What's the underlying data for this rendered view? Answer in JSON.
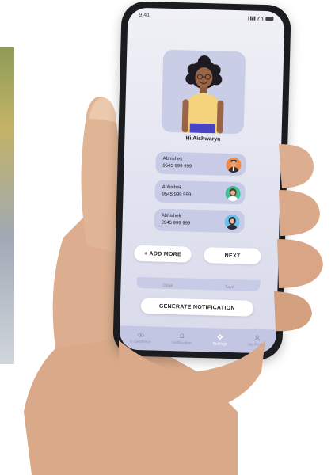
{
  "status": {
    "time": "9:41"
  },
  "greeting": "Hi Aishwarya",
  "contacts": [
    {
      "name": "Abhishek",
      "phone": "9545 999 999",
      "avatar": "male-avatar"
    },
    {
      "name": "Abhishek",
      "phone": "9545 999 999",
      "avatar": "female-avatar"
    },
    {
      "name": "Abhishek",
      "phone": "9545 999 999",
      "avatar": "female-avatar-2"
    }
  ],
  "buttons": {
    "add_more": "+ ADD MORE",
    "next": "NEXT",
    "generate": "GENERATE NOTIFICATION"
  },
  "hidden_row": {
    "left": "Close",
    "right": "Save"
  },
  "tabs": [
    {
      "label": "© Geofence",
      "icon": "eye-icon",
      "active": false
    },
    {
      "label": "Notification",
      "icon": "bell-icon",
      "active": false
    },
    {
      "label": "Settings",
      "icon": "gear-icon",
      "active": true
    },
    {
      "label": "My Profile",
      "icon": "user-icon",
      "active": false
    }
  ],
  "colors": {
    "screen_bg": "#e3e4f1",
    "card": "#c7cbe6",
    "tabbar": "#c3c6e2",
    "avatar_card": "#c9cde5"
  }
}
